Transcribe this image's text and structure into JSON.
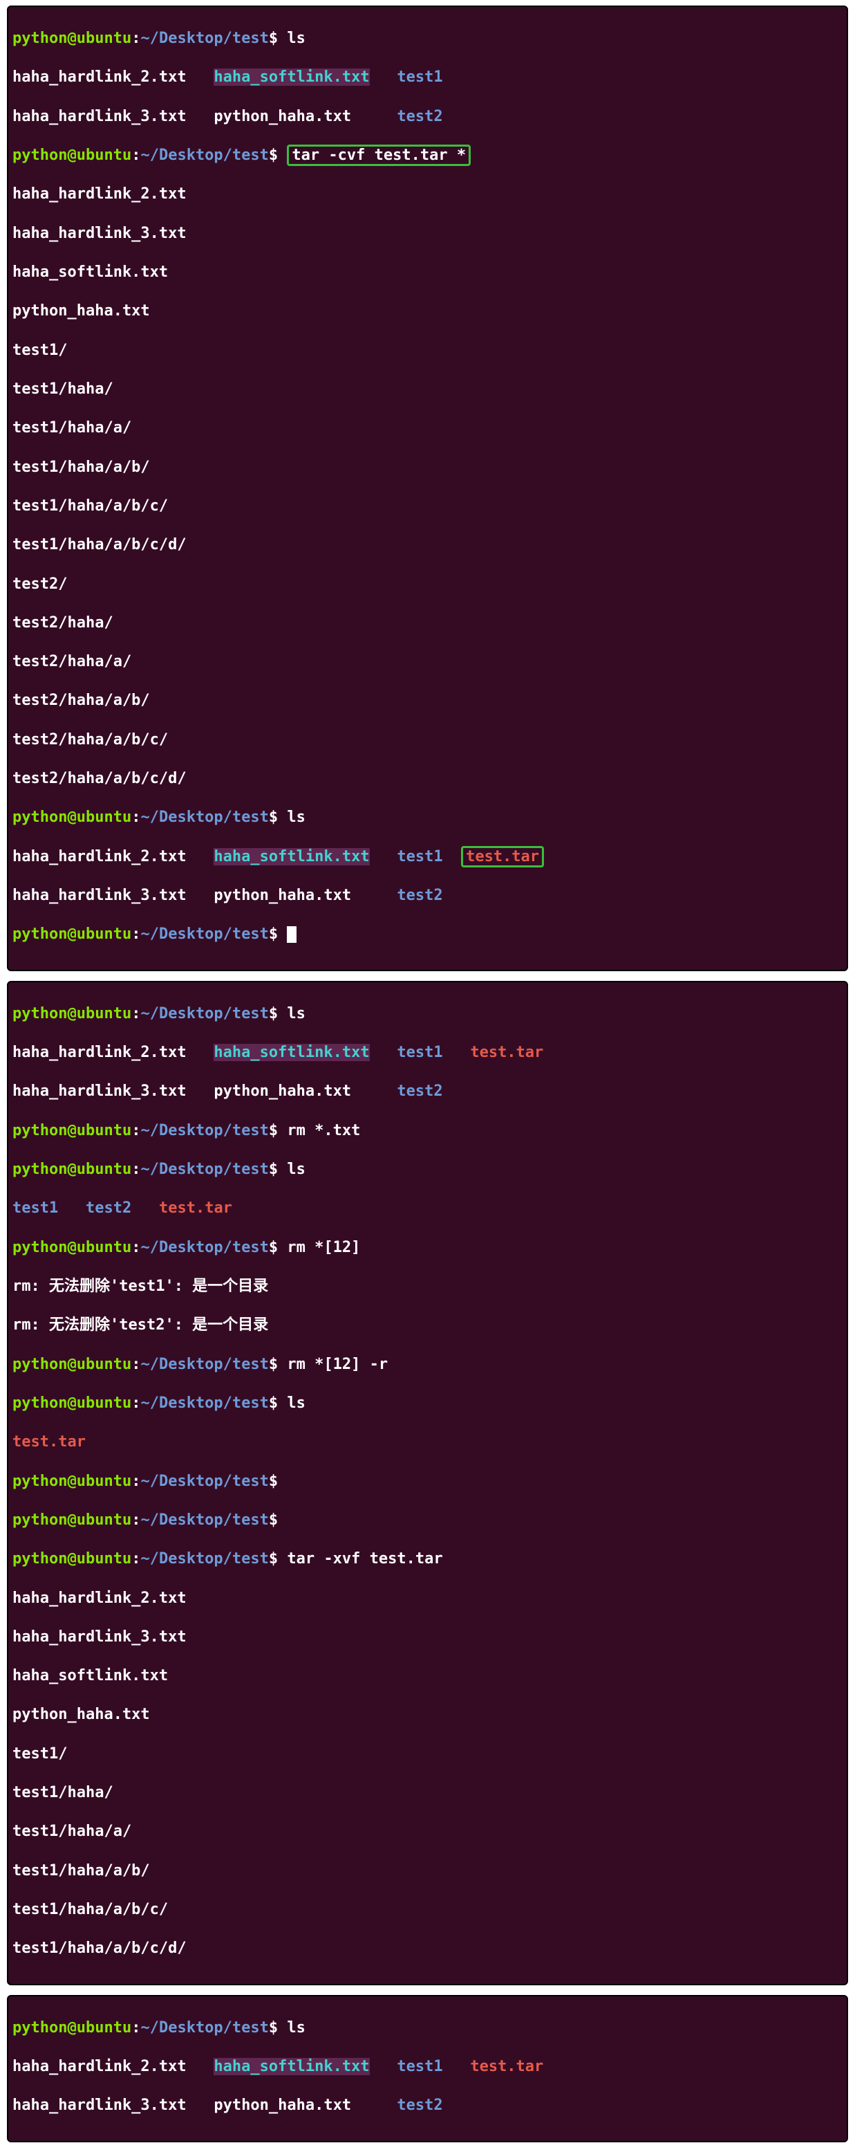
{
  "prompt": {
    "user": "python",
    "at": "@",
    "host": "ubuntu",
    "colon": ":",
    "path": "~/Desktop/test",
    "dollar": "$"
  },
  "cmds": {
    "ls": "ls",
    "tar_cvf": "tar -cvf test.tar *",
    "rm_txt": "rm *.txt",
    "rm_12": "rm *[12]",
    "rm_12r": "rm *[12] -r",
    "tar_xvf": "tar -xvf test.tar",
    "empty": ""
  },
  "ls1": {
    "r0c0": "haha_hardlink_2.txt",
    "r0c1": "haha_softlink.txt",
    "r0c2": "test1",
    "r1c0": "haha_hardlink_3.txt",
    "r1c1": "python_haha.txt",
    "r1c2": "test2"
  },
  "tarout": [
    "haha_hardlink_2.txt",
    "haha_hardlink_3.txt",
    "haha_softlink.txt",
    "python_haha.txt",
    "test1/",
    "test1/haha/",
    "test1/haha/a/",
    "test1/haha/a/b/",
    "test1/haha/a/b/c/",
    "test1/haha/a/b/c/d/",
    "test2/",
    "test2/haha/",
    "test2/haha/a/",
    "test2/haha/a/b/",
    "test2/haha/a/b/c/",
    "test2/haha/a/b/c/d/"
  ],
  "ls2": {
    "r0c0": "haha_hardlink_2.txt",
    "r0c1": "haha_softlink.txt",
    "r0c2": "test1",
    "r0c3": "test.tar",
    "r1c0": "haha_hardlink_3.txt",
    "r1c1": "python_haha.txt",
    "r1c2": "test2"
  },
  "ls3": {
    "c0": "test1",
    "c1": "test2",
    "c2": "test.tar"
  },
  "rmerr": {
    "l1": "rm: 无法删除'test1': 是一个目录",
    "l2": "rm: 无法删除'test2': 是一个目录"
  },
  "ls4": {
    "r0": "test.tar"
  },
  "tarout2": [
    "haha_hardlink_2.txt",
    "haha_hardlink_3.txt",
    "haha_softlink.txt",
    "python_haha.txt",
    "test1/",
    "test1/haha/",
    "test1/haha/a/",
    "test1/haha/a/b/",
    "test1/haha/a/b/c/",
    "test1/haha/a/b/c/d/"
  ]
}
